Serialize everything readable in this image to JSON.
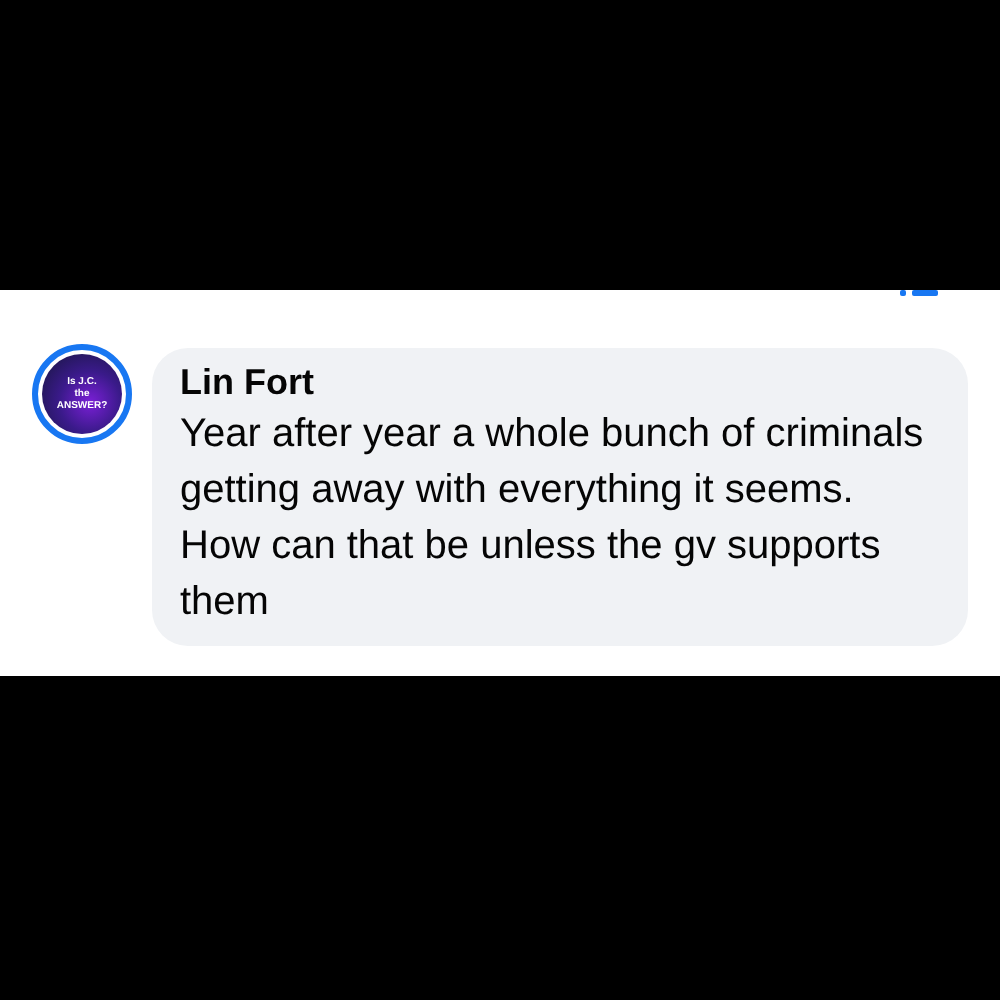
{
  "comment": {
    "avatar_text": [
      "Is J.C.",
      "the",
      "ANSWER?"
    ],
    "author": "Lin Fort",
    "text": "Year after year a whole bunch of criminals getting away with everything it seems. How can that be unless the gv supports them"
  }
}
